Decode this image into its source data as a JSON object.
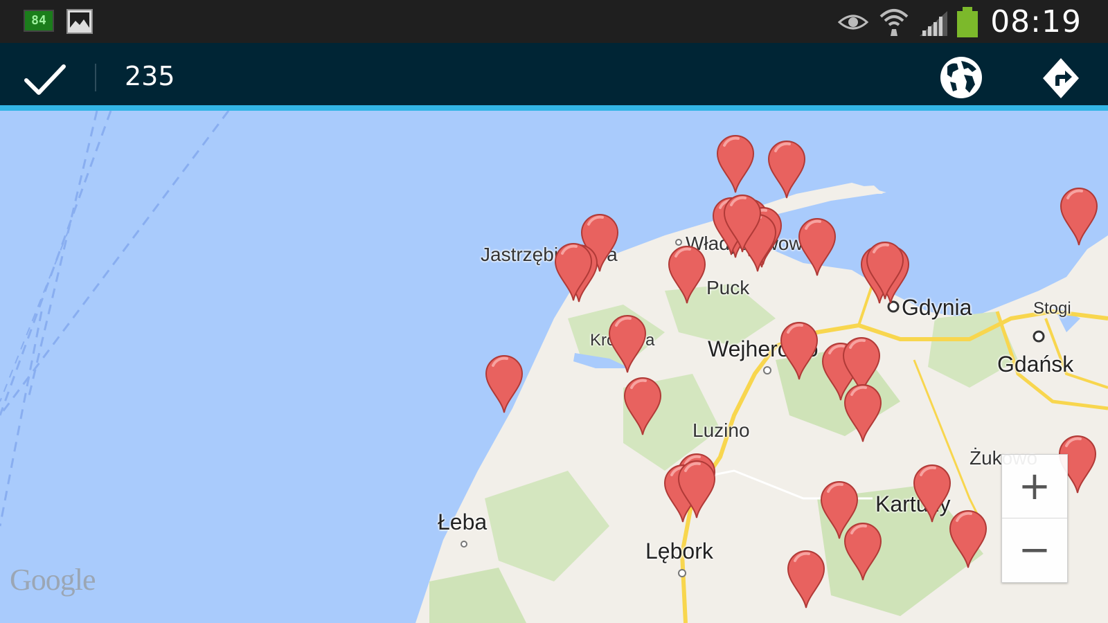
{
  "status_bar": {
    "left_badge_text": "84",
    "time": "08:19",
    "icons": [
      "battery-saver-icon",
      "gallery-icon",
      "eye-icon",
      "wifi-icon",
      "signal-icon",
      "battery-icon"
    ]
  },
  "action_bar": {
    "title": "235",
    "done_icon": "checkmark-icon",
    "actions": [
      "globe-icon",
      "directions-icon"
    ]
  },
  "map": {
    "labels": [
      {
        "id": "jastrzebia",
        "text": "Jastrzębia Góra"
      },
      {
        "id": "wladyslawowo",
        "text": "Władysławowo"
      },
      {
        "id": "puck",
        "text": "Puck"
      },
      {
        "id": "gdynia",
        "text": "Gdynia"
      },
      {
        "id": "stogi",
        "text": "Stogi"
      },
      {
        "id": "krokowa",
        "text": "Krokowa"
      },
      {
        "id": "wejherowo",
        "text": "Wejherowo"
      },
      {
        "id": "gdansk",
        "text": "Gdańsk"
      },
      {
        "id": "luzino",
        "text": "Luzino"
      },
      {
        "id": "zukowo",
        "text": "Żukowo"
      },
      {
        "id": "leba",
        "text": "Łeba"
      },
      {
        "id": "kartuzy",
        "text": "Kartuzy"
      },
      {
        "id": "lebork",
        "text": "Lębork"
      }
    ],
    "attribution": "Google",
    "zoom_in_label": "+",
    "zoom_out_label": "−",
    "marker_count_visible": 34
  },
  "colors": {
    "status_bar": "#1f1f1f",
    "action_bar": "#002535",
    "accent_underline": "#33b5e5",
    "water": "#a9cbfc",
    "land": "#f2efe9",
    "forest": "#cfe3b8",
    "road": "#f8d64e",
    "marker": "#e8625f"
  }
}
